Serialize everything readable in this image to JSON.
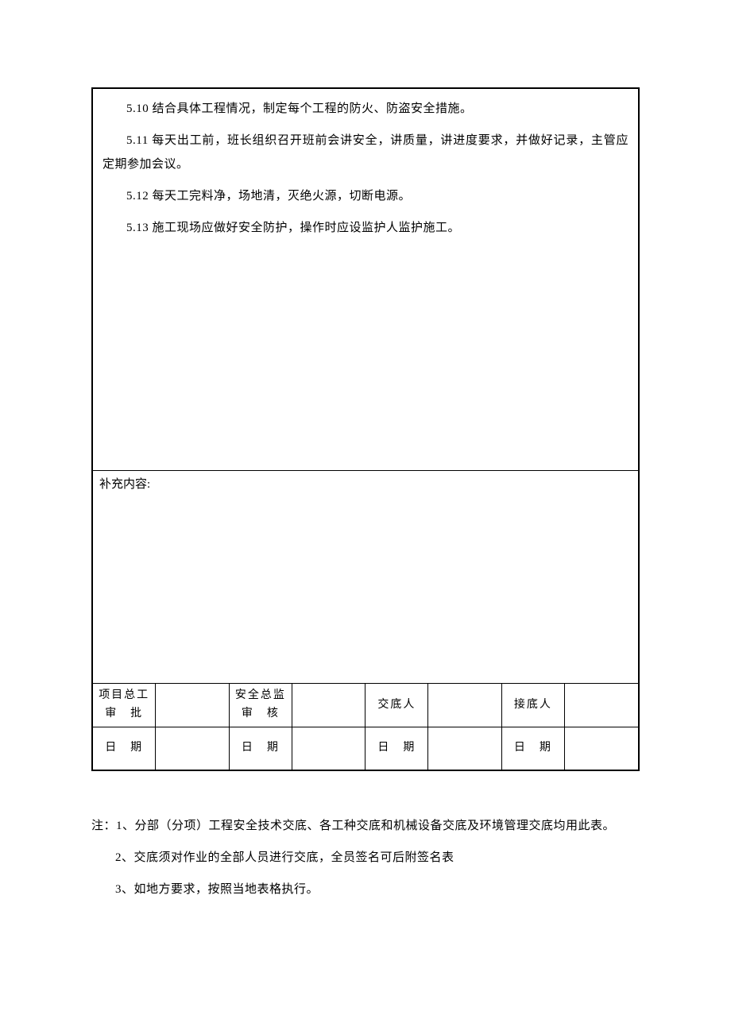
{
  "content": {
    "p1": "5.10 结合具体工程情况，制定每个工程的防火、防盗安全措施。",
    "p2": "5.11 每天出工前，班长组织召开班前会讲安全，讲质量，讲进度要求，并做好记录，主管应定期参加会议。",
    "p3": "5.12 每天工完料净，场地清，灭绝火源，切断电源。",
    "p4": "5.13 施工现场应做好安全防护，操作时应设监护人监护施工。"
  },
  "supplement": {
    "label": "补充内容:"
  },
  "sig": {
    "col1_label": "项目总工审　批",
    "col3_label": "安全总监审　核",
    "col5_label": "交底人",
    "col7_label": "接底人",
    "date_label": "日　期",
    "col1_val": "",
    "col3_val": "",
    "col5_val": "",
    "col7_val": "",
    "d1": "",
    "d3": "",
    "d5": "",
    "d7": ""
  },
  "notes": {
    "n1": "注：1、分部（分项）工程安全技术交底、各工种交底和机械设备交底及环境管理交底均用此表。",
    "n2": "2、交底须对作业的全部人员进行交底，全员签名可后附签名表",
    "n3": "3、如地方要求，按照当地表格执行。"
  }
}
